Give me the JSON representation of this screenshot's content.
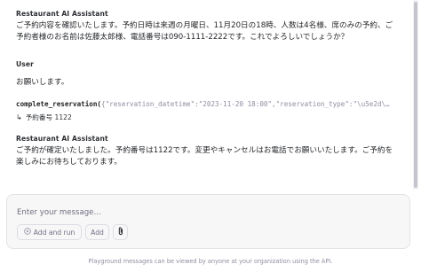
{
  "messages": [
    {
      "role": "Restaurant AI Assistant",
      "text": "ご予約内容を確認いたします。予約日時は来週の月曜日、11月20日の18時、人数は4名様、席のみの予約、ご\n予約者様のお名前は佐藤太郎様、電話番号は090-1111-2222です。これでよろしいでしょうか？"
    },
    {
      "role": "User",
      "text": "お願いします。"
    },
    {
      "role": "Restaurant AI Assistant",
      "text": "ご予約が確定いたしました。予約番号は1122です。変更やキャンセルはお電話でお願いいたします。ご予約を\n楽しみにお待ちしております。"
    }
  ],
  "tool_call": {
    "function": "complete_reservation(",
    "args": "{\"reservation_datetime\":\"2023-11-20 18:00\",\"reservation_type\":\"\\u5e2d\\…",
    "result_arrow": "↳",
    "result": "予約番号 1122"
  },
  "composer": {
    "placeholder": "Enter your message...",
    "add_and_run_label": "Add and run",
    "add_label": "Add",
    "attach_icon": "paperclip-icon",
    "run_icon": "play-icon"
  },
  "footer": {
    "notice": "Playground messages can be viewed by anyone at your organization using the API."
  }
}
